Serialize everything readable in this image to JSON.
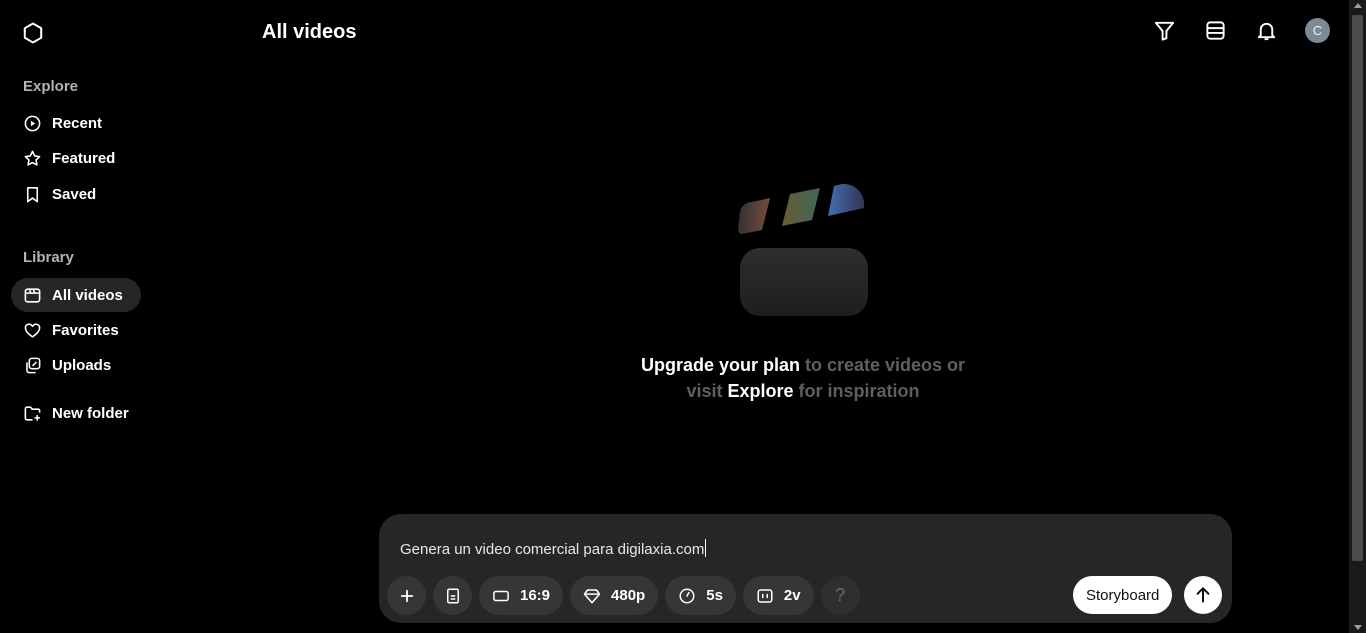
{
  "header": {
    "title": "All videos",
    "avatar_letter": "C",
    "icons": [
      "openai-logo-icon",
      "filter-icon",
      "layout-icon",
      "bell-icon"
    ]
  },
  "sidebar": {
    "explore_title": "Explore",
    "explore_items": [
      {
        "label": "Recent",
        "icon": "play-circle-icon"
      },
      {
        "label": "Featured",
        "icon": "star-icon"
      },
      {
        "label": "Saved",
        "icon": "bookmark-icon"
      }
    ],
    "library_title": "Library",
    "library_items": [
      {
        "label": "All videos",
        "icon": "video-icon",
        "active": true
      },
      {
        "label": "Favorites",
        "icon": "heart-icon"
      },
      {
        "label": "Uploads",
        "icon": "uploads-icon"
      }
    ],
    "new_folder_label": "New folder"
  },
  "empty_state": {
    "upgrade_link": "Upgrade your plan",
    "text_1": " to create videos or",
    "text_2": "visit ",
    "explore_link": "Explore",
    "text_3": " for inspiration"
  },
  "composer": {
    "prompt_value": "Genera un video comercial para digilaxia.com",
    "aspect_ratio": "16:9",
    "resolution": "480p",
    "duration": "5s",
    "variations": "2v",
    "help_label": "?",
    "storyboard_label": "Storyboard"
  },
  "colors": {
    "background": "#000000",
    "panel": "#262626",
    "active_nav": "#262626",
    "muted_text": "#5f5f5f",
    "avatar": "#7b8a94"
  }
}
